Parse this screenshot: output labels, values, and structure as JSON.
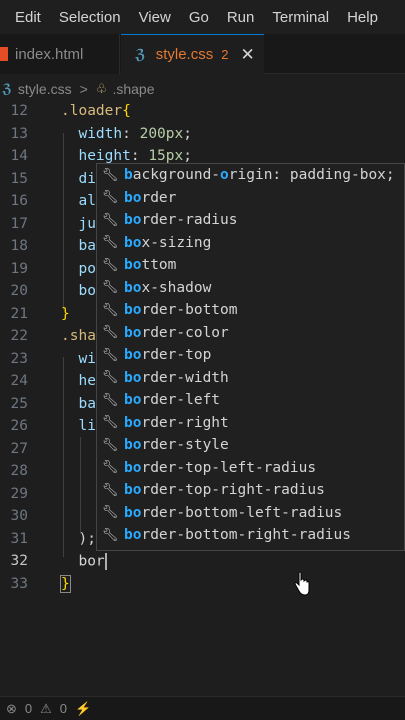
{
  "menu": [
    "Edit",
    "Selection",
    "View",
    "Go",
    "Run",
    "Terminal",
    "Help"
  ],
  "tabs": [
    {
      "label": "index.html"
    },
    {
      "label": "style.css",
      "badge": "2",
      "close": "✕"
    }
  ],
  "breadcrumb": {
    "file": "style.css",
    "separator": ">",
    "symbol": ".shape"
  },
  "lines": {
    "l12": "12",
    "l13": "13",
    "l14": "14",
    "l15": "15",
    "l16": "16",
    "l17": "17",
    "l18": "18",
    "l19": "19",
    "l20": "20",
    "l21": "21",
    "l22": "22",
    "l23": "23",
    "l24": "24",
    "l25": "25",
    "l26": "26",
    "l27": "27",
    "l28": "28",
    "l29": "29",
    "l30": "30",
    "l31": "31",
    "l32": "32",
    "l33": "33"
  },
  "code": {
    "selector_loader": ".loader",
    "open_brace": "{",
    "close_brace": "}",
    "width_prop": "width",
    "width_num": "200",
    "width_unit": "px",
    "height_prop": "height",
    "height_num": "15",
    "height_unit": "px",
    "p15": "di",
    "p16": "al",
    "p17": "ju",
    "p18": "ba",
    "p19": "po",
    "p20": "bo",
    "selector_shape": ".sha",
    "p23": "wi",
    "p24": "he",
    "p25": "ba",
    "p26": "li",
    "p31": ");",
    "typed": "bor"
  },
  "suggestions": [
    {
      "match": "b",
      "rest1": "ackground-",
      "match2": "o",
      "rest2": "rigin: padding-box;"
    },
    {
      "match": "bo",
      "rest": "rder"
    },
    {
      "match": "bo",
      "rest": "rder-radius"
    },
    {
      "match": "bo",
      "rest": "x-sizing"
    },
    {
      "match": "bo",
      "rest": "ttom"
    },
    {
      "match": "bo",
      "rest": "x-shadow"
    },
    {
      "match": "bo",
      "rest": "rder-bottom"
    },
    {
      "match": "bo",
      "rest": "rder-color"
    },
    {
      "match": "bo",
      "rest": "rder-top"
    },
    {
      "match": "bo",
      "rest": "rder-width"
    },
    {
      "match": "bo",
      "rest": "rder-left"
    },
    {
      "match": "bo",
      "rest": "rder-right"
    },
    {
      "match": "bo",
      "rest": "rder-style"
    },
    {
      "match": "bo",
      "rest": "rder-top-left-radius"
    },
    {
      "match": "bo",
      "rest": "rder-top-right-radius"
    },
    {
      "match": "bo",
      "rest": "rder-bottom-left-radius"
    },
    {
      "match": "bo",
      "rest": "rder-bottom-right-radius"
    }
  ],
  "status": {
    "errors": "0",
    "warnings": "0"
  }
}
